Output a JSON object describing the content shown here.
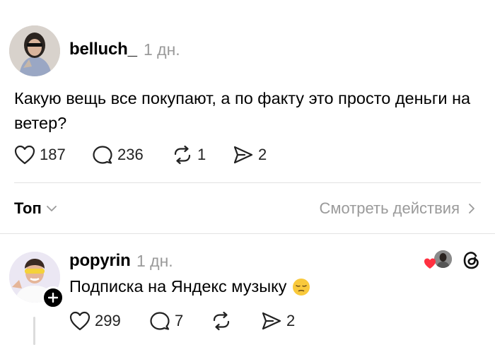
{
  "post": {
    "username": "belluch_",
    "timestamp": "1 дн.",
    "text": "Какую вещь все покупают, а по факту это просто деньги на ветер?",
    "likes": "187",
    "comments": "236",
    "reposts": "1",
    "shares": "2"
  },
  "replies_bar": {
    "sort_label": "Топ",
    "view_activity_label": "Смотреть действия"
  },
  "reply": {
    "username": "popyrin",
    "timestamp": "1 дн.",
    "text": "Подписка на Яндекс музыку",
    "emoji": "😔",
    "likes": "299",
    "comments": "7",
    "reposts": "",
    "shares": "2"
  },
  "colors": {
    "muted": "#9a9a9a",
    "like_heart": "#ff3040",
    "divider": "#e2e2e2"
  },
  "icons": [
    "heart-icon",
    "comment-icon",
    "repost-icon",
    "share-icon",
    "chevron-down-icon",
    "chevron-right-icon",
    "plus-icon",
    "threads-icon"
  ]
}
